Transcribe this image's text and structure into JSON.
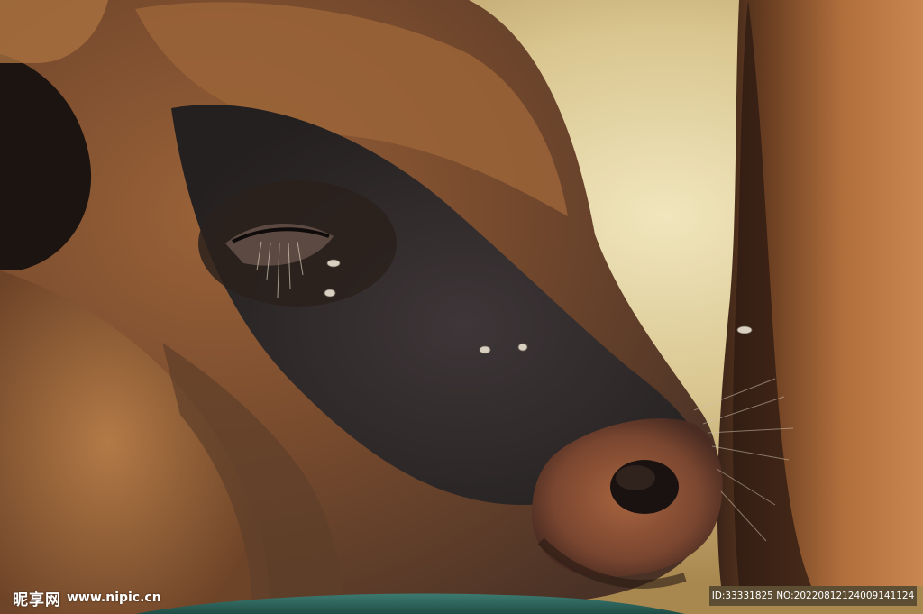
{
  "image": {
    "subject": "close-up profile of a young bison calf head with flies near its eye and snout",
    "palette": {
      "fur_light": "#b97d45",
      "fur_mid": "#8a5531",
      "fur_dark": "#3a2a22",
      "face_dark": "#2e2a2c",
      "background_light": "#e8dcae",
      "rail_teal": "#2f6a62",
      "right_animal": "#a86a3a"
    }
  },
  "watermark": {
    "brand": "昵享网",
    "url": "www.nipic.cn",
    "id_text": "ID:33331825 NO:20220812124009141124"
  }
}
